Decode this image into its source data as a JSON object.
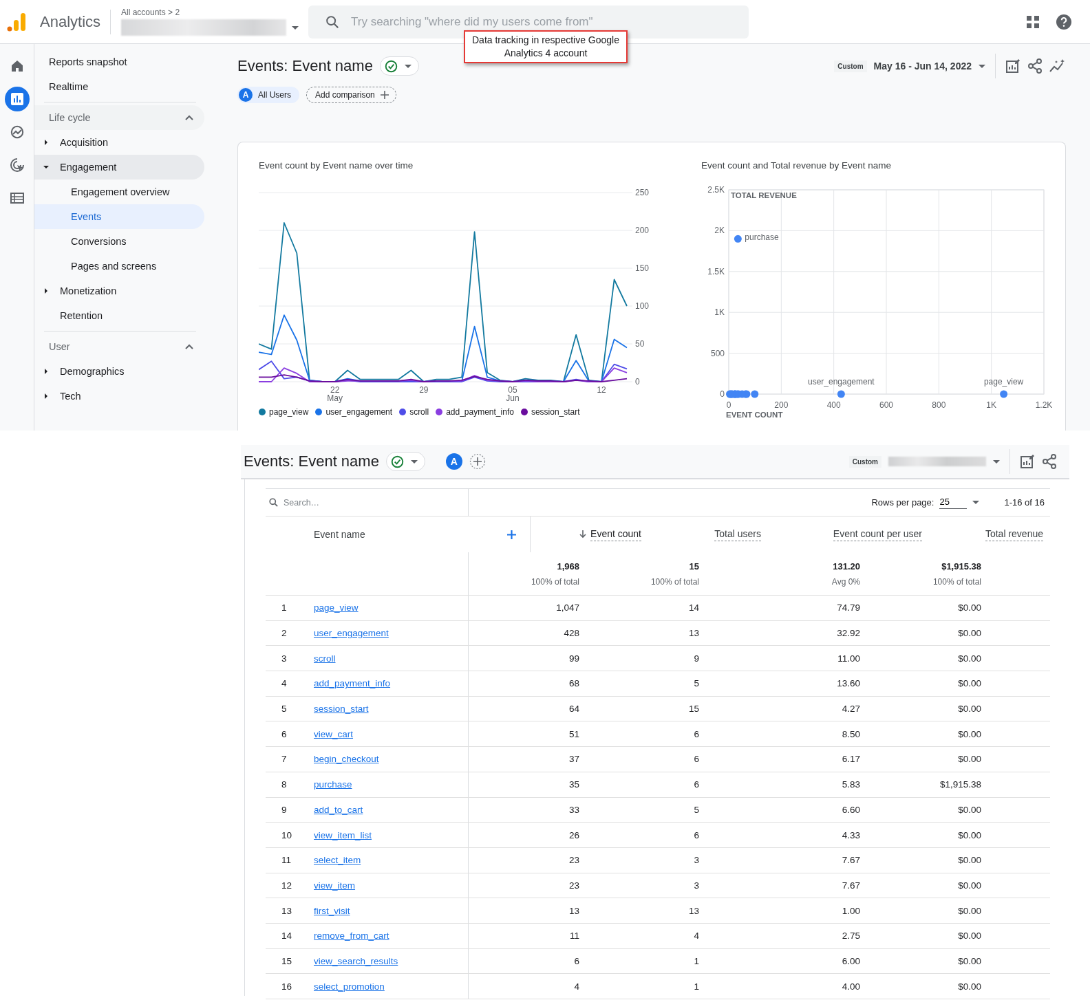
{
  "header": {
    "product": "Analytics",
    "breadcrumb": "All accounts > 2",
    "search_placeholder": "Try searching \"where did my users come from\""
  },
  "annotation": {
    "text": "Data tracking in respective Google Analytics 4 account"
  },
  "rail": [
    {
      "kind": "home",
      "selected": false
    },
    {
      "kind": "reports",
      "selected": true
    },
    {
      "kind": "explore",
      "selected": false
    },
    {
      "kind": "advertising",
      "selected": false
    },
    {
      "kind": "configure",
      "selected": false
    }
  ],
  "nav": {
    "top": [
      {
        "label": "Reports snapshot",
        "selected": false
      },
      {
        "label": "Realtime",
        "selected": false
      }
    ],
    "sections": [
      {
        "title": "Life cycle",
        "expanded": true,
        "items": [
          {
            "label": "Acquisition",
            "kind": "group",
            "expanded": false,
            "selected": false
          },
          {
            "label": "Engagement",
            "kind": "group",
            "expanded": true,
            "selected": false,
            "children": [
              {
                "label": "Engagement overview",
                "selected": false
              },
              {
                "label": "Events",
                "selected": true
              },
              {
                "label": "Conversions",
                "selected": false
              },
              {
                "label": "Pages and screens",
                "selected": false
              }
            ]
          },
          {
            "label": "Monetization",
            "kind": "group",
            "expanded": false,
            "selected": false
          },
          {
            "label": "Retention",
            "kind": "link",
            "selected": false
          }
        ]
      },
      {
        "title": "User",
        "expanded": true,
        "items": [
          {
            "label": "Demographics",
            "kind": "group",
            "expanded": false,
            "selected": false
          },
          {
            "label": "Tech",
            "kind": "group",
            "expanded": false,
            "selected": false
          }
        ]
      }
    ]
  },
  "report": {
    "title": "Events: Event name",
    "comparison": {
      "badge": "A",
      "label": "All Users"
    },
    "add_comparison": "Add comparison",
    "date_kind": "Custom",
    "date_range": "May 16 - Jun 14, 2022",
    "charts": [
      {
        "chart_data": {
          "type": "line",
          "title": "Event count by Event name over time",
          "categories": [
            null,
            null,
            null,
            null,
            null,
            null,
            "22 May",
            null,
            null,
            null,
            null,
            null,
            null,
            "29",
            null,
            null,
            null,
            null,
            null,
            null,
            "05 Jun",
            null,
            null,
            null,
            null,
            null,
            null,
            "12",
            null,
            null
          ],
          "grid": true,
          "legend": true,
          "series": [
            {
              "name": "page_view",
              "color": "#12799f",
              "values": [
                50,
                43,
                210,
                170,
                2,
                0,
                0,
                15,
                3,
                3,
                3,
                3,
                15,
                0,
                3,
                3,
                6,
                198,
                12,
                2,
                0,
                4,
                2,
                2,
                0,
                62,
                2,
                0,
                135,
                100
              ]
            },
            {
              "name": "user_engagement",
              "color": "#1a73e8",
              "values": [
                39,
                36,
                88,
                55,
                2,
                0,
                0,
                4,
                1,
                1,
                1,
                1,
                1,
                0,
                1,
                1,
                1,
                73,
                6,
                1,
                0,
                2,
                1,
                1,
                0,
                28,
                1,
                0,
                56,
                45
              ]
            },
            {
              "name": "scroll",
              "color": "#4f4de8",
              "values": [
                16,
                27,
                4,
                6,
                1,
                0,
                0,
                2,
                0,
                0,
                0,
                0,
                0,
                0,
                0,
                0,
                0,
                6,
                1,
                0,
                0,
                0,
                0,
                0,
                0,
                3,
                0,
                0,
                23,
                17
              ]
            },
            {
              "name": "add_payment_info",
              "color": "#8a3ee0",
              "values": [
                0,
                0,
                18,
                11,
                0,
                0,
                0,
                1,
                1,
                1,
                1,
                1,
                2,
                0,
                1,
                1,
                1,
                8,
                2,
                1,
                0,
                1,
                0,
                0,
                0,
                2,
                0,
                0,
                18,
                12
              ]
            },
            {
              "name": "session_start",
              "color": "#6a0d9e",
              "values": [
                6,
                6,
                9,
                6,
                1,
                0,
                0,
                3,
                1,
                1,
                1,
                1,
                3,
                0,
                1,
                1,
                2,
                7,
                3,
                1,
                0,
                2,
                1,
                1,
                0,
                2,
                1,
                0,
                2,
                4
              ]
            }
          ],
          "ylim": [
            0,
            250
          ],
          "yticks": [
            0,
            50,
            100,
            150,
            200,
            250
          ]
        }
      },
      {
        "chart_data": {
          "type": "scatter",
          "title": "Event count and Total revenue by Event name",
          "xlabel": "EVENT COUNT",
          "ylabel": "TOTAL REVENUE",
          "x": [
            1047,
            428,
            99,
            68,
            64,
            51,
            37,
            35,
            33,
            26,
            23,
            23,
            13,
            11,
            6,
            4
          ],
          "series": [
            {
              "color": "#4285f4",
              "values": [
                0,
                0,
                0,
                0,
                0,
                0,
                0,
                1900,
                0,
                0,
                0,
                0,
                0,
                0,
                0,
                0
              ]
            }
          ],
          "xlim": [
            0,
            1200
          ],
          "ylim": [
            0,
            2500
          ],
          "grid": true,
          "xticks": [
            0,
            200,
            400,
            600,
            800,
            {
              "value": 1000,
              "label": "1K"
            },
            {
              "value": 1200,
              "label": "1.2K"
            }
          ],
          "yticks": [
            0,
            500,
            {
              "value": 1000,
              "label": "1K"
            },
            {
              "value": 1500,
              "label": "1.5K"
            },
            {
              "value": 2000,
              "label": "2K"
            },
            {
              "value": 2500,
              "label": "2.5K"
            }
          ],
          "annotations": [
            {
              "x": 35,
              "y": 1915.38,
              "text": "purchase"
            },
            {
              "x": 428,
              "y": 0,
              "text": "user_engagement"
            },
            {
              "x": 1047,
              "y": 0,
              "text": "page_view"
            }
          ]
        }
      }
    ]
  },
  "table_view": {
    "title": "Events: Event name",
    "badge": "A",
    "date_kind": "Custom",
    "search_placeholder": "Search…",
    "rows_per_page_label": "Rows per page:",
    "rows_per_page": "25",
    "pagination": "1-16 of 16",
    "name_column": {
      "label": "Event name"
    },
    "columns": [
      {
        "label": "Event count",
        "sorted": true
      },
      {
        "label": "Total users",
        "sorted": false
      },
      {
        "label": "Event count per user",
        "sorted": false
      },
      {
        "label": "Total revenue",
        "sorted": false
      }
    ],
    "totals": [
      {
        "value": "1,968",
        "note": "100% of total"
      },
      {
        "value": "15",
        "note": "100% of total"
      },
      {
        "value": "131.20",
        "note": "Avg 0%"
      },
      {
        "value": "$1,915.38",
        "note": "100% of total"
      }
    ],
    "rows": [
      {
        "index": "1",
        "event": "page_view",
        "cells": [
          "1,047",
          "14",
          "74.79",
          "$0.00"
        ]
      },
      {
        "index": "2",
        "event": "user_engagement",
        "cells": [
          "428",
          "13",
          "32.92",
          "$0.00"
        ]
      },
      {
        "index": "3",
        "event": "scroll",
        "cells": [
          "99",
          "9",
          "11.00",
          "$0.00"
        ]
      },
      {
        "index": "4",
        "event": "add_payment_info",
        "cells": [
          "68",
          "5",
          "13.60",
          "$0.00"
        ]
      },
      {
        "index": "5",
        "event": "session_start",
        "cells": [
          "64",
          "15",
          "4.27",
          "$0.00"
        ]
      },
      {
        "index": "6",
        "event": "view_cart",
        "cells": [
          "51",
          "6",
          "8.50",
          "$0.00"
        ]
      },
      {
        "index": "7",
        "event": "begin_checkout",
        "cells": [
          "37",
          "6",
          "6.17",
          "$0.00"
        ]
      },
      {
        "index": "8",
        "event": "purchase",
        "cells": [
          "35",
          "6",
          "5.83",
          "$1,915.38"
        ]
      },
      {
        "index": "9",
        "event": "add_to_cart",
        "cells": [
          "33",
          "5",
          "6.60",
          "$0.00"
        ]
      },
      {
        "index": "10",
        "event": "view_item_list",
        "cells": [
          "26",
          "6",
          "4.33",
          "$0.00"
        ]
      },
      {
        "index": "11",
        "event": "select_item",
        "cells": [
          "23",
          "3",
          "7.67",
          "$0.00"
        ]
      },
      {
        "index": "12",
        "event": "view_item",
        "cells": [
          "23",
          "3",
          "7.67",
          "$0.00"
        ]
      },
      {
        "index": "13",
        "event": "first_visit",
        "cells": [
          "13",
          "13",
          "1.00",
          "$0.00"
        ]
      },
      {
        "index": "14",
        "event": "remove_from_cart",
        "cells": [
          "11",
          "4",
          "2.75",
          "$0.00"
        ]
      },
      {
        "index": "15",
        "event": "view_search_results",
        "cells": [
          "6",
          "1",
          "6.00",
          "$0.00"
        ]
      },
      {
        "index": "16",
        "event": "select_promotion",
        "cells": [
          "4",
          "1",
          "4.00",
          "$0.00"
        ]
      }
    ]
  }
}
